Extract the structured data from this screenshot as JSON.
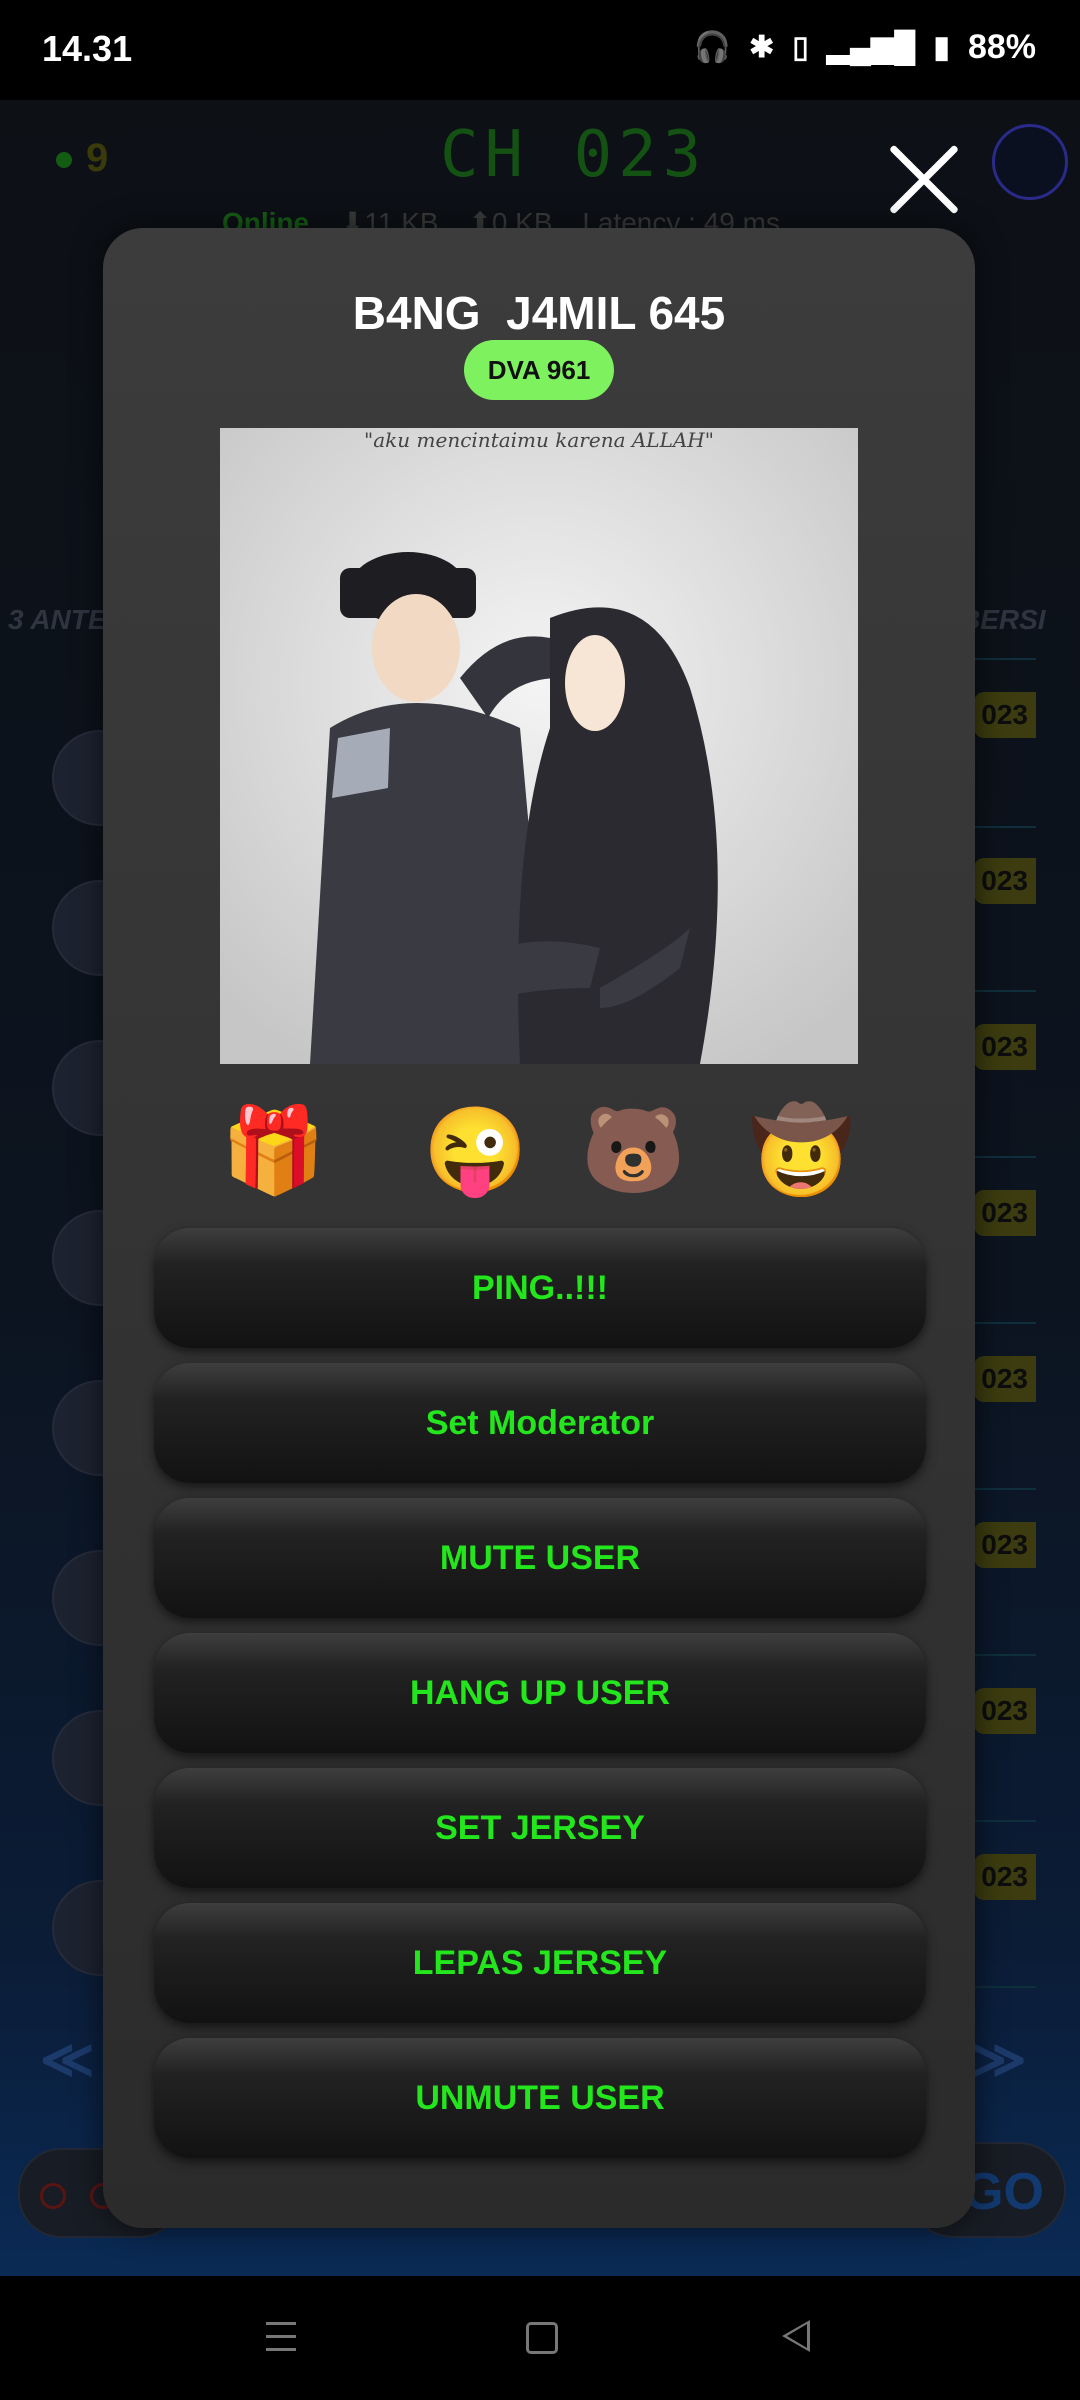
{
  "status_bar": {
    "time": "14.31",
    "battery": "88%",
    "icons": [
      "headphones-icon",
      "bluetooth-icon",
      "vibrate-icon",
      "volte-icon",
      "signal-icon",
      "signal-4g-icon",
      "battery-charging-icon"
    ]
  },
  "background": {
    "channel_title": "CH 023",
    "listener_count": "9",
    "online_label": "Online",
    "download": "⬇11 KB",
    "upload": "⬆0 KB",
    "latency": "Latency : 49 ms",
    "marquee_left": "3 ANTE",
    "marquee_right": "BERSI",
    "side_tags": [
      "023",
      "023",
      "023",
      "023",
      "023",
      "023",
      "023",
      "023"
    ],
    "arrow_left": "≪",
    "arrow_right": "≫",
    "go_label": "GO"
  },
  "modal": {
    "user_name": "B4NG  J4MIL 645",
    "user_id": "DVA 961",
    "photo_caption": "\"aku mencintaimu karena ALLAH\"",
    "reactions": [
      {
        "name": "gift-icon",
        "glyph": "🎁"
      },
      {
        "name": "wink-emoji-icon",
        "glyph": "😜"
      },
      {
        "name": "bear-sticker-icon",
        "glyph": "🐻"
      },
      {
        "name": "cowboy-crying-emoji-icon",
        "glyph": "🤠"
      }
    ],
    "buttons": [
      "PING..!!!",
      "Set Moderator",
      "MUTE USER",
      "HANG UP USER",
      "SET JERSEY",
      "LEPAS JERSEY",
      "UNMUTE USER"
    ]
  },
  "colors": {
    "accent_green": "#23e61c",
    "badge_green": "#7ef25e",
    "modal_bg": "#333333"
  }
}
